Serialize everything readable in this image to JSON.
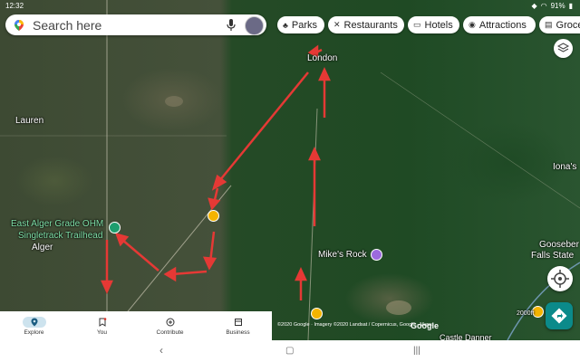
{
  "status_bar": {
    "time": "12:32",
    "battery": "91%"
  },
  "search": {
    "placeholder": "Search here"
  },
  "chips": [
    {
      "label": "Parks",
      "icon": "tree-icon"
    },
    {
      "label": "Restaurants",
      "icon": "fork-knife-icon"
    },
    {
      "label": "Hotels",
      "icon": "bed-icon"
    },
    {
      "label": "Attractions",
      "icon": "camera-icon"
    },
    {
      "label": "Groce",
      "icon": "cart-icon"
    }
  ],
  "map": {
    "labels": {
      "london": "London",
      "lauren": "Lauren",
      "east_alger_1": "East Alger Grade OHM",
      "east_alger_2": "Singletrack Trailhead",
      "alger": "Alger",
      "mikes_rock": "Mike's Rock",
      "ionas": "Iona's",
      "gooseberry_1": "Gooseber",
      "gooseberry_2": "Falls State",
      "castle_danner": "Castle Danner",
      "elevation": "2000ft"
    },
    "attribution": "©2020 Google · Imagery ©2020 Landsat / Copernicus, Google · Maps",
    "google_logo": "Google"
  },
  "bottom_nav": [
    {
      "label": "Explore",
      "active": true
    },
    {
      "label": "You",
      "active": false
    },
    {
      "label": "Contribute",
      "active": false
    },
    {
      "label": "Business",
      "active": false
    }
  ],
  "colors": {
    "accent": "#1a73e8",
    "arrow_red": "#e53935",
    "poi_green": "#1e9e6e",
    "poi_yellow": "#f4b400",
    "poi_purple": "#9c6ade",
    "directions_teal": "#0b8a8a"
  }
}
